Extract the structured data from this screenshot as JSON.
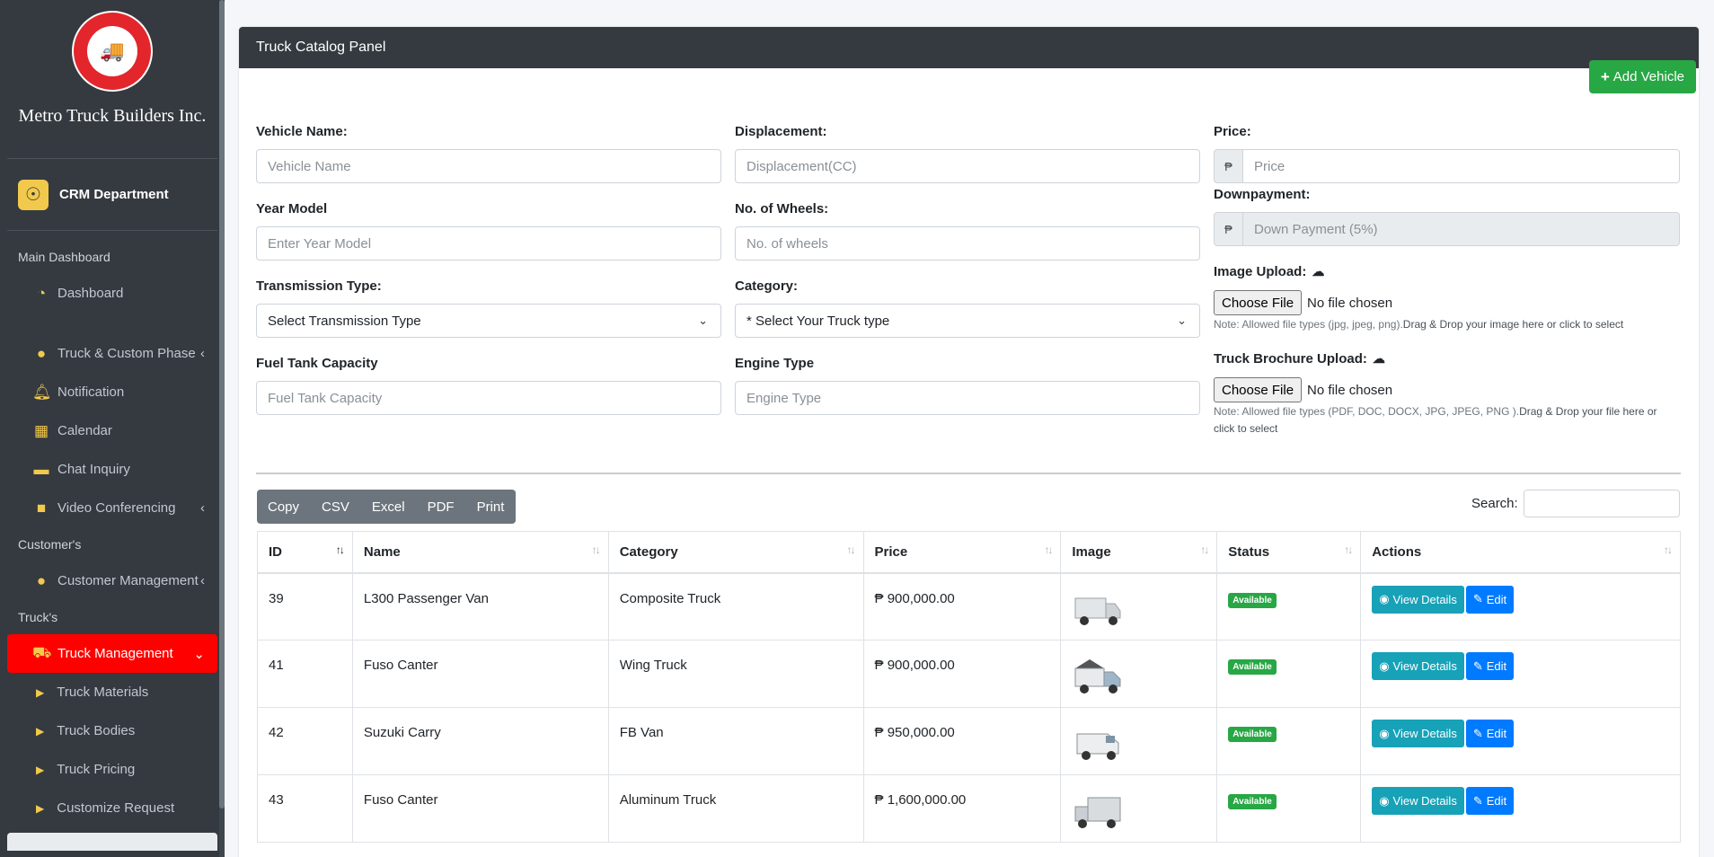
{
  "sidebar": {
    "brand_name": "Metro Truck Builders Inc.",
    "department": "CRM Department",
    "sections": [
      {
        "header": "Main Dashboard"
      },
      {
        "header": "Customer's"
      },
      {
        "header": "Truck's"
      }
    ],
    "items": {
      "dashboard": "Dashboard",
      "truck_custom_phase": "Truck & Custom Phase",
      "notification": "Notification",
      "calendar": "Calendar",
      "chat_inquiry": "Chat Inquiry",
      "video_conferencing": "Video Conferencing",
      "customer_management": "Customer Management",
      "truck_management": "Truck Management",
      "truck_materials": "Truck Materials",
      "truck_bodies": "Truck Bodies",
      "truck_pricing": "Truck Pricing",
      "customize_request": "Customize Request"
    }
  },
  "panel": {
    "title": "Truck Catalog Panel",
    "add_button": "Add Vehicle"
  },
  "form": {
    "vehicle_name": {
      "label": "Vehicle Name:",
      "placeholder": "Vehicle Name"
    },
    "displacement": {
      "label": "Displacement:",
      "placeholder": "Displacement(CC)"
    },
    "price": {
      "label": "Price:",
      "placeholder": "Price",
      "currency": "₱"
    },
    "year_model": {
      "label": "Year Model",
      "placeholder": "Enter Year Model"
    },
    "wheels": {
      "label": "No. of Wheels:",
      "placeholder": "No. of wheels"
    },
    "downpayment": {
      "label": "Downpayment:",
      "placeholder": "Down Payment (5%)",
      "currency": "₱"
    },
    "transmission": {
      "label": "Transmission Type:",
      "value": "Select Transmission Type"
    },
    "category": {
      "label": "Category:",
      "value": "* Select Your Truck type"
    },
    "image_upload": {
      "label": "Image Upload:",
      "button": "Choose File",
      "status": "No file chosen",
      "note": "Note: Allowed file types (jpg, jpeg, png).",
      "note_drag": "Drag & Drop your image here or click to select"
    },
    "fuel_tank": {
      "label": "Fuel Tank Capacity",
      "placeholder": "Fuel Tank Capacity"
    },
    "engine_type": {
      "label": "Engine Type",
      "placeholder": "Engine Type"
    },
    "brochure_upload": {
      "label": "Truck Brochure Upload:",
      "button": "Choose File",
      "status": "No file chosen",
      "note": "Note: Allowed file types (PDF, DOC, DOCX, JPG, JPEG, PNG ).",
      "note_drag": "Drag & Drop your file here or click to select"
    }
  },
  "table_tools": {
    "exports": [
      "Copy",
      "CSV",
      "Excel",
      "PDF",
      "Print"
    ],
    "search_label": "Search:"
  },
  "table": {
    "headers": [
      "ID",
      "Name",
      "Category",
      "Price",
      "Image",
      "Status",
      "Actions"
    ],
    "rows": [
      {
        "id": "39",
        "name": "L300 Passenger Van",
        "category": "Composite Truck",
        "price": "₱ 900,000.00",
        "status": "Available"
      },
      {
        "id": "41",
        "name": "Fuso Canter",
        "category": "Wing Truck",
        "price": "₱ 900,000.00",
        "status": "Available"
      },
      {
        "id": "42",
        "name": "Suzuki Carry",
        "category": "FB Van",
        "price": "₱ 950,000.00",
        "status": "Available"
      },
      {
        "id": "43",
        "name": "Fuso Canter",
        "category": "Aluminum Truck",
        "price": "₱ 1,600,000.00",
        "status": "Available"
      }
    ],
    "view_label": "View Details",
    "edit_label": "Edit"
  },
  "colors": {
    "sidebar_bg": "#343a40",
    "active_item": "#ff0000",
    "accent_yellow": "#f2c94c",
    "add_green": "#28a745",
    "view_teal": "#17a2b8",
    "edit_blue": "#007bff"
  }
}
